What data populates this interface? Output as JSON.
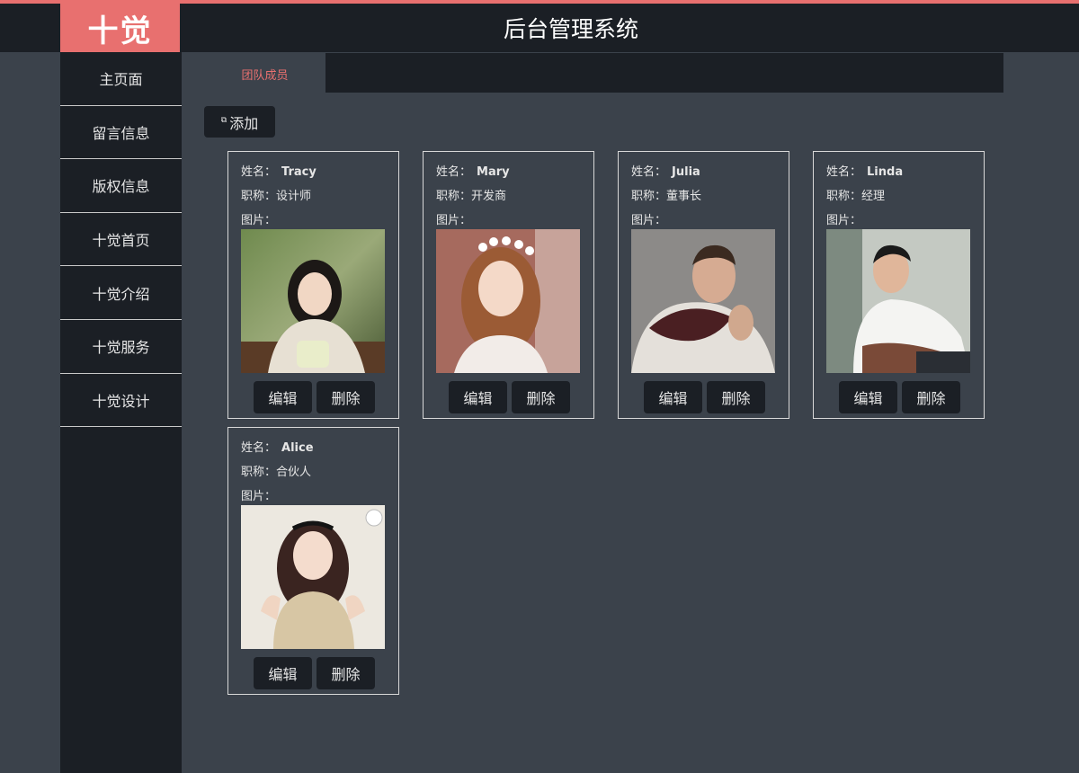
{
  "header": {
    "logo_text": "十觉",
    "title": "后台管理系统",
    "accent_color": "#e8706f",
    "dark_bg": "#1b1f25"
  },
  "sidebar": {
    "items": [
      {
        "label": "主页面"
      },
      {
        "label": "留言信息"
      },
      {
        "label": "版权信息"
      },
      {
        "label": "十觉首页"
      },
      {
        "label": "十觉介绍"
      },
      {
        "label": "十觉服务"
      },
      {
        "label": "十觉设计"
      }
    ]
  },
  "tabs": [
    {
      "label": "团队成员",
      "active": true
    }
  ],
  "toolbar": {
    "add_label": "添加",
    "add_icon": "link-icon"
  },
  "labels": {
    "name": "姓名：",
    "title": "职称：",
    "photo": "图片：",
    "edit": "编辑",
    "delete": "删除"
  },
  "members": [
    {
      "name": "Tracy",
      "title": "设计师",
      "photo": "photo-woman-outdoor"
    },
    {
      "name": "Mary",
      "title": "开发商",
      "photo": "photo-woman-flower-crown"
    },
    {
      "name": "Julia",
      "title": "董事长",
      "photo": "photo-man-scarf"
    },
    {
      "name": "Linda",
      "title": "经理",
      "photo": "photo-man-white-shirt"
    },
    {
      "name": "Alice",
      "title": "合伙人",
      "photo": "photo-woman-wavy-hair"
    }
  ]
}
